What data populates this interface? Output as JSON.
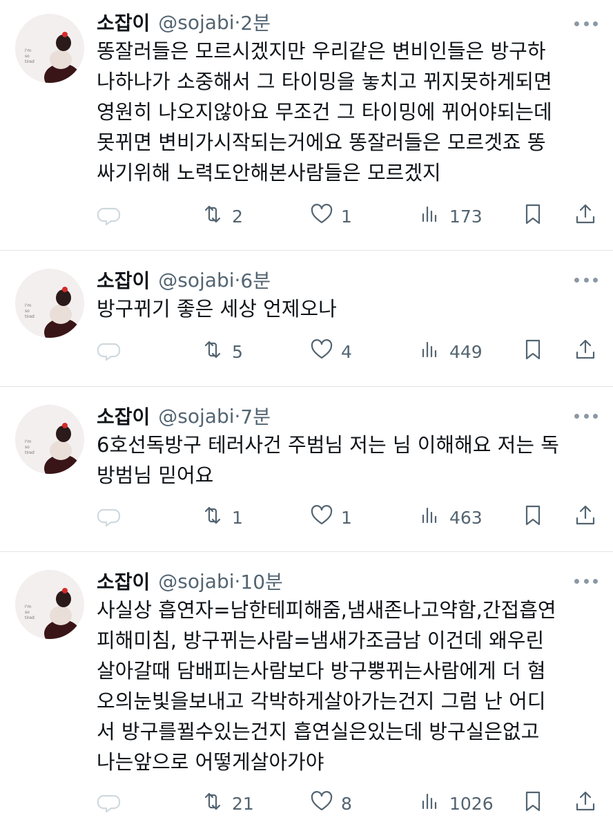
{
  "tweets": [
    {
      "name": "소잡이",
      "handle": "@sojabi",
      "sep": "·",
      "time": "2분",
      "lines": [
        "똥잘러들은 모르시겠지만 우리같은 변비인들은 방구하",
        "나하나가 소중해서  그 타이밍을 놓치고 뀌지못하게되면",
        "영원히 나오지않아요  무조건 그 타이밍에 뀌어야되는데",
        "못뀌면 변비가시작되는거에요 똥잘러들은 모르겟죠  똥",
        "싸기위해 노력도안해본사람들은 모르겠지"
      ],
      "retweets": "2",
      "likes": "1",
      "views": "173"
    },
    {
      "name": "소잡이",
      "handle": "@sojabi",
      "sep": "·",
      "time": "6분",
      "lines": [
        "방구뀌기 좋은 세상 언제오나"
      ],
      "retweets": "5",
      "likes": "4",
      "views": "449"
    },
    {
      "name": "소잡이",
      "handle": "@sojabi",
      "sep": "·",
      "time": "7분",
      "lines": [
        "6호선독방구 테러사건 주범님 저는  님 이해해요 저는 독",
        "방범님 믿어요"
      ],
      "retweets": "1",
      "likes": "1",
      "views": "463"
    },
    {
      "name": "소잡이",
      "handle": "@sojabi",
      "sep": "·",
      "time": "10분",
      "lines": [
        "사실상  흡연자=남한테피해줌,냄새존나고약함,간접흡연",
        "피해미침,   방구뀌는사람=냄새가조금남  이건데 왜우린",
        "살아갈때 담배피는사람보다 방구뿡뀌는사람에게 더 혐",
        "오의눈빛을보내고 각박하게살아가는건지 그럼 난  어디",
        "서 방구를뀔수있는건지 흡연실은있는데 방구실은없고",
        "나는앞으로 어떻게살아가야"
      ],
      "retweets": "21",
      "likes": "8",
      "views": "1026"
    }
  ],
  "avatar_caption": [
    "I'm",
    "so",
    "tired"
  ],
  "icons": {
    "reply": "reply-icon",
    "retweet": "retweet-icon",
    "like": "heart-icon",
    "views": "views-icon",
    "bookmark": "bookmark-icon",
    "share": "share-icon",
    "more": "more-icon"
  },
  "colors": {
    "text": "#0f1419",
    "secondary": "#536471",
    "divider": "#e1e4e8"
  }
}
